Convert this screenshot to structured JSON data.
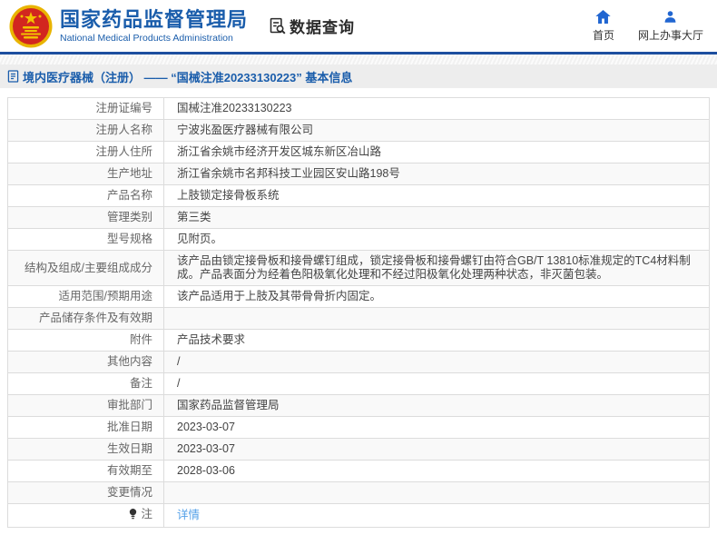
{
  "header": {
    "org_name_cn": "国家药品监督管理局",
    "org_name_en": "National Medical Products Administration",
    "section_title": "数据查询",
    "nav": [
      {
        "label": "首页",
        "icon": "home-icon"
      },
      {
        "label": "网上办事大厅",
        "icon": "user-icon"
      }
    ]
  },
  "breadcrumb": {
    "icon": "document-icon",
    "text": "境内医疗器械（注册） —— “国械注准20233130223” 基本信息"
  },
  "table": {
    "rows": [
      {
        "label": "注册证编号",
        "value": "国械注准20233130223"
      },
      {
        "label": "注册人名称",
        "value": "宁波兆盈医疗器械有限公司"
      },
      {
        "label": "注册人住所",
        "value": "浙江省余姚市经济开发区城东新区冶山路"
      },
      {
        "label": "生产地址",
        "value": "浙江省余姚市名邦科技工业园区安山路198号"
      },
      {
        "label": "产品名称",
        "value": "上肢锁定接骨板系统"
      },
      {
        "label": "管理类别",
        "value": "第三类"
      },
      {
        "label": "型号规格",
        "value": "见附页。"
      },
      {
        "label": "结构及组成/主要组成成分",
        "value": "该产品由锁定接骨板和接骨螺钉组成，锁定接骨板和接骨螺钉由符合GB/T 13810标准规定的TC4材料制成。产品表面分为经着色阳极氧化处理和不经过阳极氧化处理两种状态，非灭菌包装。"
      },
      {
        "label": "适用范围/预期用途",
        "value": "该产品适用于上肢及其带骨骨折内固定。"
      },
      {
        "label": "产品储存条件及有效期",
        "value": ""
      },
      {
        "label": "附件",
        "value": "产品技术要求"
      },
      {
        "label": "其他内容",
        "value": "/"
      },
      {
        "label": "备注",
        "value": "/"
      },
      {
        "label": "审批部门",
        "value": "国家药品监督管理局"
      },
      {
        "label": "批准日期",
        "value": "2023-03-07"
      },
      {
        "label": "生效日期",
        "value": "2023-03-07"
      },
      {
        "label": "有效期至",
        "value": "2028-03-06"
      },
      {
        "label": "变更情况",
        "value": ""
      },
      {
        "label": "注",
        "value": "详情",
        "value_is_link": true,
        "label_icon": "bulb-icon"
      }
    ]
  },
  "colors": {
    "brand_blue": "#1a5dab",
    "header_border_blue": "#1d4f9f",
    "nav_icon_blue": "#2166d1",
    "link_blue": "#53a0e8",
    "emblem_red": "#d2261f",
    "emblem_gold": "#f2c300",
    "breadcrumb_bg": "#ededed",
    "alt_row_bg": "#f9f9f9",
    "table_border": "#dcdcdc"
  }
}
